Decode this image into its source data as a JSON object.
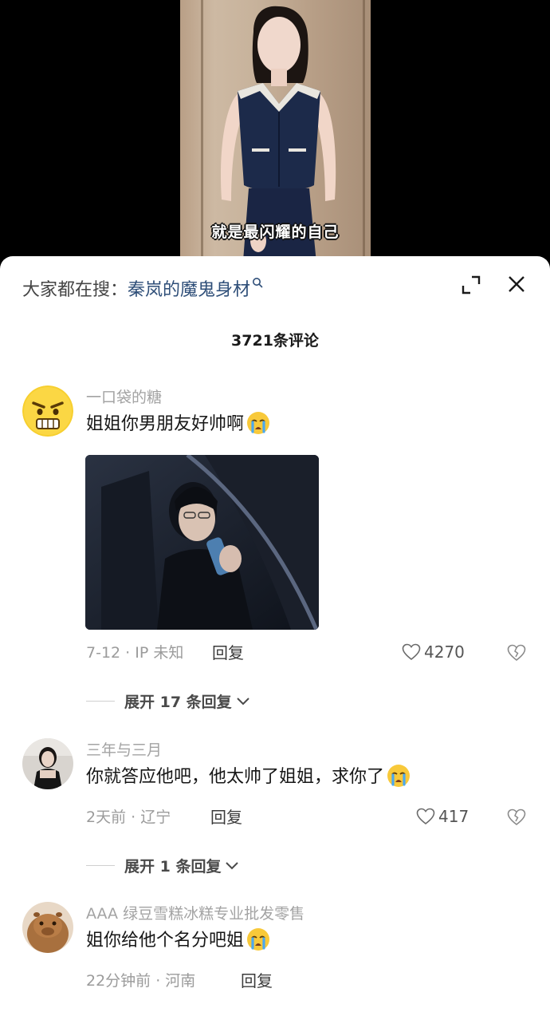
{
  "video": {
    "subtitle": "就是最闪耀的自己"
  },
  "sheet": {
    "search_prefix": "大家都在搜：",
    "search_term": "秦岚的魔鬼身材",
    "comment_count": "3721条评论"
  },
  "comments": [
    {
      "username": "一口袋的糖",
      "text": "姐姐你男朋友好帅啊",
      "meta": "7-12 · IP 未知",
      "reply_label": "回复",
      "likes": "4270",
      "expand_label": "展开 17 条回复",
      "has_image": true,
      "avatar_icon": "angry-face-avatar-icon",
      "emoji_icon": "crying-face-icon"
    },
    {
      "username": "三年与三月",
      "text": "你就答应他吧，他太帅了姐姐，求你了",
      "meta": "2天前 · 辽宁",
      "reply_label": "回复",
      "likes": "417",
      "expand_label": "展开 1 条回复",
      "avatar_icon": "person-photo-avatar",
      "emoji_icon": "crying-face-icon"
    },
    {
      "username": "AAA 绿豆雪糕冰糕专业批发零售",
      "text": "姐你给他个名分吧姐",
      "meta": "22分钟前 · 河南",
      "reply_label": "回复",
      "avatar_icon": "capybara-avatar",
      "emoji_icon": "crying-face-icon"
    }
  ],
  "colors": {
    "sheet_bg": "#ffffff",
    "link": "#2e4e78",
    "muted": "#a3a3a3",
    "text": "#161616"
  }
}
